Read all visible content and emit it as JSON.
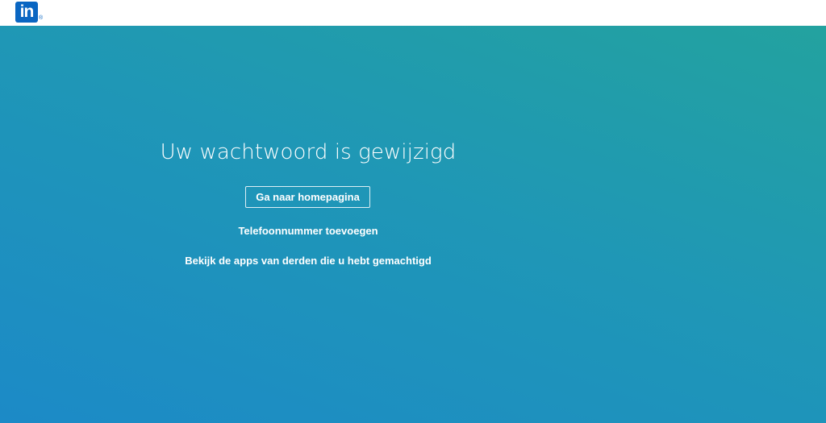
{
  "header": {
    "logo_text": "in",
    "logo_registered": "®"
  },
  "main": {
    "title": "Uw wachtwoord is gewijzigd",
    "home_button_label": "Ga naar homepagina",
    "add_phone_link": "Telefoonnummer toevoegen",
    "apps_link": "Bekijk de apps van derden die u hebt gemachtigd"
  },
  "colors": {
    "brand_blue": "#0a66c2",
    "gradient_top_right": "#23a29f",
    "gradient_bottom_left": "#1c8ac7",
    "text": "#ffffff"
  }
}
